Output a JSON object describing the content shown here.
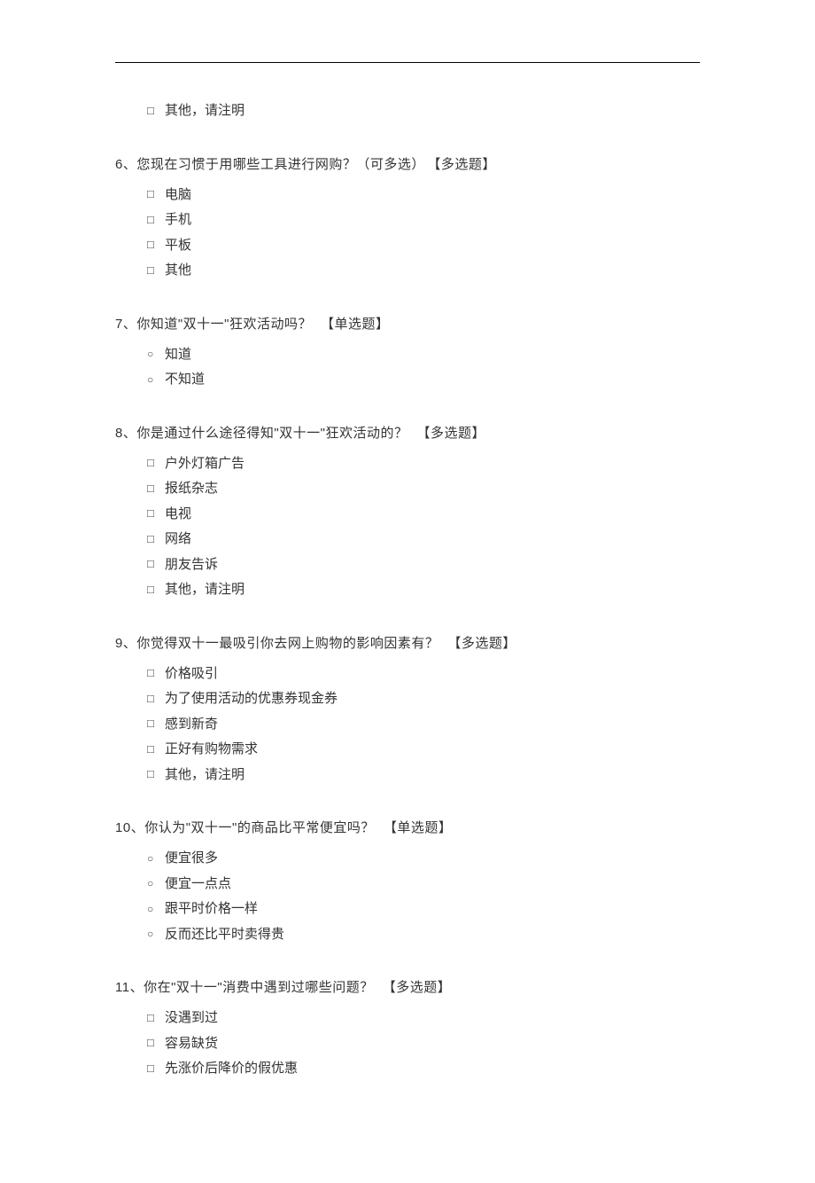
{
  "orphan_option": "其他，请注明",
  "questions": [
    {
      "number": "6",
      "text": "您现在习惯于用哪些工具进行网购？（可多选）",
      "tag": "【多选题】",
      "type": "multi",
      "options": [
        "电脑",
        "手机",
        "平板",
        "其他"
      ]
    },
    {
      "number": "7",
      "text": "你知道\"双十一\"狂欢活动吗？",
      "tag": "【单选题】",
      "type": "single",
      "options": [
        "知道",
        "不知道"
      ]
    },
    {
      "number": "8",
      "text": "你是通过什么途径得知\"双十一\"狂欢活动的？",
      "tag": "【多选题】",
      "type": "multi",
      "options": [
        "户外灯箱广告",
        "报纸杂志",
        "电视",
        "网络",
        "朋友告诉",
        "其他，请注明"
      ]
    },
    {
      "number": "9",
      "text": "你觉得双十一最吸引你去网上购物的影响因素有？",
      "tag": "【多选题】",
      "type": "multi",
      "options": [
        "价格吸引",
        "为了使用活动的优惠券现金券",
        "感到新奇",
        "正好有购物需求",
        "其他，请注明"
      ]
    },
    {
      "number": "10",
      "text": "你认为\"双十一\"的商品比平常便宜吗？",
      "tag": "【单选题】",
      "type": "single",
      "options": [
        "便宜很多",
        "便宜一点点",
        "跟平时价格一样",
        "反而还比平时卖得贵"
      ]
    },
    {
      "number": "11",
      "text": "你在\"双十一\"消费中遇到过哪些问题？",
      "tag": "【多选题】",
      "type": "multi",
      "options": [
        "没遇到过",
        "容易缺货",
        "先涨价后降价的假优惠"
      ]
    }
  ]
}
